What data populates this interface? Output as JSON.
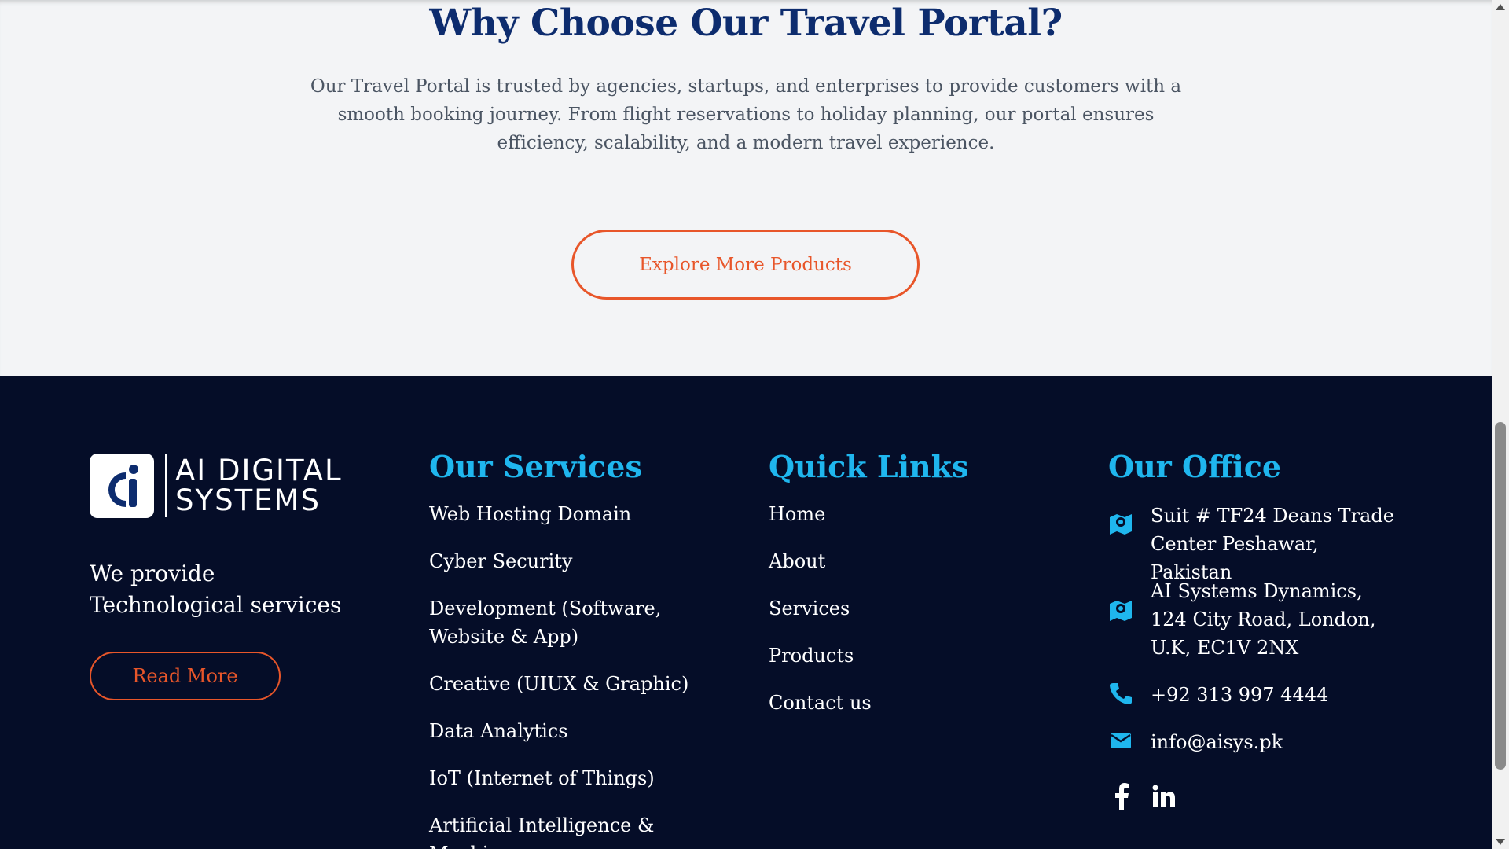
{
  "section": {
    "title": "Why Choose Our Travel Portal?",
    "description": "Our Travel Portal is trusted by agencies, startups, and enterprises to provide customers with a smooth booking journey. From flight reservations to holiday planning, our portal ensures efficiency, scalability, and a modern travel experience.",
    "button_label": "Explore More Products"
  },
  "footer": {
    "logo": {
      "line1": "AI DIGITAL",
      "line2": "SYSTEMS"
    },
    "tagline": "We provide Technological services",
    "read_more_label": "Read More",
    "services": {
      "title": "Our Services",
      "items": [
        "Web Hosting Domain",
        "Cyber Security",
        "Development (Software, Website & App)",
        "Creative (UIUX & Graphic)",
        "Data Analytics",
        "IoT (Internet of Things)",
        "Artificial Intelligence & Machine"
      ]
    },
    "quick_links": {
      "title": "Quick Links",
      "items": [
        "Home",
        "About",
        "Services",
        "Products",
        "Contact us"
      ]
    },
    "office": {
      "title": "Our Office",
      "address1": "Suit # TF24 Deans Trade Center Peshawar, Pakistan",
      "address2": "AI Systems Dynamics, 124 City Road, London, U.K, EC1V 2NX",
      "phone": "+92 313 997 4444",
      "email": "info@aisys.pk"
    },
    "social": [
      "facebook-icon",
      "linkedin-icon"
    ],
    "colors": {
      "accent": "#1fb6ee",
      "cta": "#e8562a",
      "background": "#050d28",
      "heading": "#0d2c6e"
    }
  }
}
